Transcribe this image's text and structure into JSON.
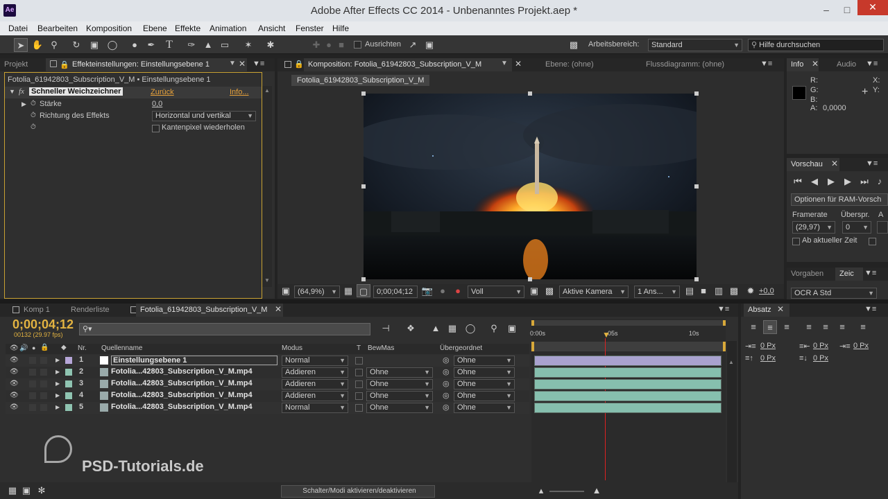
{
  "window": {
    "title": "Adobe After Effects CC 2014 - Unbenanntes Projekt.aep *",
    "app_icon": "Ae"
  },
  "menu": [
    "Datei",
    "Bearbeiten",
    "Komposition",
    "Ebene",
    "Effekte",
    "Animation",
    "Ansicht",
    "Fenster",
    "Hilfe"
  ],
  "toolbar": {
    "align_label": "Ausrichten",
    "workspace_label": "Arbeitsbereich:",
    "workspace_value": "Standard",
    "help_placeholder": "Hilfe durchsuchen"
  },
  "effects_panel": {
    "tab_project": "Projekt",
    "tab_effects": "Effekteinstellungen: Einstellungsebene 1",
    "breadcrumb": "Fotolia_61942803_Subscription_V_M • Einstellungsebene 1",
    "effect_name": "Schneller Weichzeichner",
    "reset": "Zurück",
    "info": "Info...",
    "strength_label": "Stärke",
    "strength_value": "0,0",
    "direction_label": "Richtung des Effekts",
    "direction_value": "Horizontal und vertikal",
    "repeat_label": "Kantenpixel wiederholen"
  },
  "comp_panel": {
    "tab_comp": "Komposition: Fotolia_61942803_Subscription_V_M",
    "tab_layer": "Ebene: (ohne)",
    "tab_flow": "Flussdiagramm: (ohne)",
    "comp_chip": "Fotolia_61942803_Subscription_V_M",
    "zoom": "(64,9%)",
    "timecode": "0;00;04;12",
    "resolution": "Voll",
    "camera": "Aktive Kamera",
    "views": "1 Ans...",
    "exposure": "+0,0"
  },
  "info_panel": {
    "tab_info": "Info",
    "tab_audio": "Audio",
    "r": "R:",
    "g": "G:",
    "b": "B:",
    "a": "A:",
    "a_value": "0,0000",
    "x": "X:",
    "y": "Y:"
  },
  "preview_panel": {
    "tab": "Vorschau",
    "ram_options": "Optionen für RAM-Vorsch",
    "framerate_label": "Framerate",
    "skip_label": "Überspr.",
    "framerate_value": "(29,97)",
    "skip_value": "0",
    "from_current": "Ab aktueller Zeit"
  },
  "presets_panel": {
    "tab_presets": "Vorgaben",
    "tab_char": "Zeic",
    "font": "OCR A Std"
  },
  "paragraph_panel": {
    "tab": "Absatz",
    "fields": [
      "0 Px",
      "0 Px",
      "0 Px",
      "0 Px",
      "0 Px"
    ]
  },
  "timeline": {
    "tab_comp1": "Komp 1",
    "tab_render": "Renderliste",
    "tab_active": "Fotolia_61942803_Subscription_V_M",
    "timecode": "0;00;04;12",
    "frame_info": "00132 (29.97 fps)",
    "search_placeholder": "",
    "col_nr": "Nr.",
    "col_source": "Quellenname",
    "col_mode": "Modus",
    "col_t": "T",
    "col_trkmat": "BewMas",
    "col_parent": "Übergeordnet",
    "ruler": [
      "0:00s",
      "05s",
      "10s"
    ],
    "layers": [
      {
        "nr": "1",
        "name": "Einstellungsebene 1",
        "mode": "Normal",
        "trkmat": "",
        "parent": "Ohne",
        "color": "#b6a6d8"
      },
      {
        "nr": "2",
        "name": "Fotolia...42803_Subscription_V_M.mp4",
        "mode": "Addieren",
        "trkmat": "Ohne",
        "parent": "Ohne",
        "color": "#8fc4b1"
      },
      {
        "nr": "3",
        "name": "Fotolia...42803_Subscription_V_M.mp4",
        "mode": "Addieren",
        "trkmat": "Ohne",
        "parent": "Ohne",
        "color": "#8fc4b1"
      },
      {
        "nr": "4",
        "name": "Fotolia...42803_Subscription_V_M.mp4",
        "mode": "Addieren",
        "trkmat": "Ohne",
        "parent": "Ohne",
        "color": "#8fc4b1"
      },
      {
        "nr": "5",
        "name": "Fotolia...42803_Subscription_V_M.mp4",
        "mode": "Normal",
        "trkmat": "Ohne",
        "parent": "Ohne",
        "color": "#8fc4b1"
      }
    ],
    "toggle_label": "Schalter/Modi aktivieren/deaktivieren"
  },
  "watermark": "PSD-Tutorials.de",
  "colors": {
    "accent": "#e8a23a",
    "timecode": "#e3b341",
    "playhead": "#d22",
    "adj_bar": "#a9a2cf",
    "video_bar": "#86bfae"
  }
}
